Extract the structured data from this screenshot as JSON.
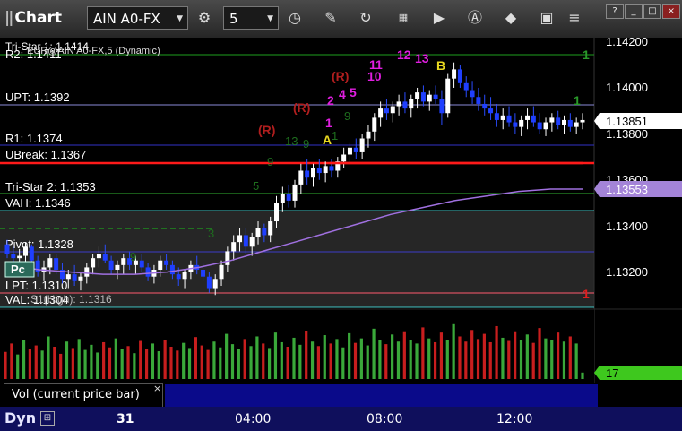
{
  "toolbar": {
    "title": "Chart",
    "symbol": "AIN A0-FX",
    "interval": "5",
    "icons": [
      "gear-icon",
      "clock-icon",
      "pencil-icon",
      "refresh-icon",
      "calculator-icon",
      "play-icon",
      "alert-icon",
      "tag-icon",
      "snapshot-icon",
      "list-icon"
    ],
    "window_buttons": [
      "?",
      "_",
      "□",
      "×"
    ]
  },
  "chart_data": {
    "type": "candlestick",
    "instrument": "AIN A0-FX",
    "interval": "5",
    "price_axis": {
      "range": [
        1.3105,
        1.3426
      ],
      "ticks": [
        "1.14200",
        "1.14000",
        "1.13800",
        "1.13600",
        "1.13400",
        "1.13200"
      ],
      "last_price": "1.13851",
      "ma_price": "1.13553"
    },
    "levels": [
      {
        "label": "R2: 1.1411",
        "value": 1.1411,
        "color": "#1ea01e"
      },
      {
        "label": "UPT: 1.1392",
        "value": 1.1392,
        "color": "#8a8ad8"
      },
      {
        "label": "R1: 1.1374",
        "value": 1.1374,
        "color": "#3232c8"
      },
      {
        "label": "UBreak: 1.1367",
        "value": 1.1367,
        "color": "#ff1a1a"
      },
      {
        "label": "Tri-Star 2: 1.1353",
        "value": 1.1353,
        "color": "#32b432"
      },
      {
        "label": "VAH: 1.1346",
        "value": 1.1346,
        "color": "#46c8c8"
      },
      {
        "label": "Pivot: 1.1328",
        "value": 1.1328,
        "color": "#3c3cc8"
      },
      {
        "label": "LPT: 1.1310",
        "value": 1.131,
        "color": "#ff5a6e"
      },
      {
        "label": "VAL: 1.1304",
        "value": 1.1304,
        "color": "#46c8c8"
      }
    ],
    "overlay_text": [
      "Tri-Star 1: 1.1414",
      "EUR@AIN A0-FX,5 (Dynamic)",
      "S1(High): 1.1316"
    ],
    "annotations": {
      "red": [
        "(R)",
        "(R)",
        "(R)"
      ],
      "magenta": [
        "1",
        "2",
        "4",
        "5",
        "11",
        "10",
        "12",
        "13"
      ],
      "yellow": [
        "A",
        "B"
      ],
      "green": [
        "1",
        "1"
      ],
      "red_count": [
        "1"
      ]
    },
    "ohlc": [
      [
        1.1331,
        1.1333,
        1.1325,
        1.1327
      ],
      [
        1.1327,
        1.133,
        1.1322,
        1.1325
      ],
      [
        1.1325,
        1.1329,
        1.1321,
        1.1326
      ],
      [
        1.1326,
        1.1332,
        1.1323,
        1.133
      ],
      [
        1.133,
        1.1331,
        1.1322,
        1.1324
      ],
      [
        1.1324,
        1.1326,
        1.1317,
        1.1319
      ],
      [
        1.1319,
        1.1324,
        1.1315,
        1.1321
      ],
      [
        1.1321,
        1.1327,
        1.1318,
        1.1325
      ],
      [
        1.1325,
        1.1327,
        1.1318,
        1.132
      ],
      [
        1.132,
        1.1323,
        1.1314,
        1.1316
      ],
      [
        1.1316,
        1.132,
        1.1312,
        1.1318
      ],
      [
        1.1318,
        1.1322,
        1.1313,
        1.1315
      ],
      [
        1.1315,
        1.1319,
        1.1311,
        1.1317
      ],
      [
        1.1317,
        1.1323,
        1.1314,
        1.1321
      ],
      [
        1.1321,
        1.1327,
        1.1318,
        1.1325
      ],
      [
        1.1325,
        1.133,
        1.1321,
        1.1327
      ],
      [
        1.1327,
        1.1331,
        1.1323,
        1.1324
      ],
      [
        1.1324,
        1.1326,
        1.1318,
        1.132
      ],
      [
        1.132,
        1.1324,
        1.1316,
        1.1322
      ],
      [
        1.1322,
        1.1327,
        1.1318,
        1.1325
      ],
      [
        1.1325,
        1.1328,
        1.132,
        1.1322
      ],
      [
        1.1322,
        1.1326,
        1.1318,
        1.1324
      ],
      [
        1.1324,
        1.1327,
        1.1319,
        1.1321
      ],
      [
        1.1321,
        1.1323,
        1.1315,
        1.1317
      ],
      [
        1.1317,
        1.1322,
        1.1314,
        1.132
      ],
      [
        1.132,
        1.1326,
        1.1317,
        1.1324
      ],
      [
        1.1324,
        1.1327,
        1.132,
        1.1322
      ],
      [
        1.1322,
        1.1324,
        1.1316,
        1.1318
      ],
      [
        1.1318,
        1.1321,
        1.1313,
        1.1316
      ],
      [
        1.1316,
        1.132,
        1.1312,
        1.1319
      ],
      [
        1.1319,
        1.1324,
        1.1316,
        1.1322
      ],
      [
        1.1322,
        1.1326,
        1.1318,
        1.132
      ],
      [
        1.132,
        1.1323,
        1.1315,
        1.1317
      ],
      [
        1.1317,
        1.1319,
        1.131,
        1.1312
      ],
      [
        1.1312,
        1.1318,
        1.1309,
        1.1316
      ],
      [
        1.1316,
        1.1324,
        1.1313,
        1.1322
      ],
      [
        1.1322,
        1.133,
        1.1319,
        1.1328
      ],
      [
        1.1328,
        1.1335,
        1.1324,
        1.1332
      ],
      [
        1.1332,
        1.1338,
        1.1328,
        1.1335
      ],
      [
        1.1335,
        1.1338,
        1.1327,
        1.133
      ],
      [
        1.133,
        1.1336,
        1.1326,
        1.1334
      ],
      [
        1.1334,
        1.1341,
        1.1331,
        1.1338
      ],
      [
        1.1338,
        1.134,
        1.1332,
        1.1335
      ],
      [
        1.1335,
        1.1343,
        1.1332,
        1.1341
      ],
      [
        1.1341,
        1.1352,
        1.1338,
        1.1349
      ],
      [
        1.1349,
        1.1356,
        1.1345,
        1.1353
      ],
      [
        1.1353,
        1.1357,
        1.1347,
        1.135
      ],
      [
        1.135,
        1.1359,
        1.1347,
        1.1357
      ],
      [
        1.1357,
        1.1366,
        1.1353,
        1.1363
      ],
      [
        1.1363,
        1.1368,
        1.1357,
        1.136
      ],
      [
        1.136,
        1.1366,
        1.1356,
        1.1364
      ],
      [
        1.1364,
        1.1368,
        1.1359,
        1.1362
      ],
      [
        1.1362,
        1.1367,
        1.1358,
        1.1365
      ],
      [
        1.1365,
        1.1368,
        1.136,
        1.1363
      ],
      [
        1.1363,
        1.1369,
        1.136,
        1.1367
      ],
      [
        1.1367,
        1.1373,
        1.1364,
        1.137
      ],
      [
        1.137,
        1.1375,
        1.1366,
        1.1373
      ],
      [
        1.1373,
        1.1377,
        1.1368,
        1.1371
      ],
      [
        1.1371,
        1.1379,
        1.1368,
        1.1377
      ],
      [
        1.1377,
        1.1383,
        1.1373,
        1.138
      ],
      [
        1.138,
        1.1388,
        1.1376,
        1.1386
      ],
      [
        1.1386,
        1.1393,
        1.1382,
        1.139
      ],
      [
        1.139,
        1.1394,
        1.1385,
        1.1388
      ],
      [
        1.1388,
        1.1393,
        1.1384,
        1.1391
      ],
      [
        1.1391,
        1.1396,
        1.1387,
        1.1393
      ],
      [
        1.1393,
        1.1397,
        1.1388,
        1.139
      ],
      [
        1.139,
        1.1396,
        1.1386,
        1.1394
      ],
      [
        1.1394,
        1.1399,
        1.139,
        1.1397
      ],
      [
        1.1397,
        1.14,
        1.1391,
        1.1393
      ],
      [
        1.1393,
        1.1398,
        1.1389,
        1.1396
      ],
      [
        1.1396,
        1.14,
        1.1392,
        1.1394
      ],
      [
        1.1394,
        1.1398,
        1.1383,
        1.1388
      ],
      [
        1.1388,
        1.1405,
        1.1386,
        1.1403
      ],
      [
        1.1403,
        1.141,
        1.1399,
        1.1407
      ],
      [
        1.1407,
        1.1409,
        1.1399,
        1.1401
      ],
      [
        1.1401,
        1.1404,
        1.1395,
        1.1398
      ],
      [
        1.1398,
        1.1402,
        1.1392,
        1.1395
      ],
      [
        1.1395,
        1.1399,
        1.1389,
        1.1392
      ],
      [
        1.1392,
        1.1396,
        1.1387,
        1.139
      ],
      [
        1.139,
        1.1395,
        1.1385,
        1.1388
      ],
      [
        1.1388,
        1.1392,
        1.1382,
        1.1385
      ],
      [
        1.1385,
        1.139,
        1.1381,
        1.1387
      ],
      [
        1.1387,
        1.1391,
        1.1382,
        1.1384
      ],
      [
        1.1384,
        1.1388,
        1.1379,
        1.1382
      ],
      [
        1.1382,
        1.1387,
        1.1378,
        1.1385
      ],
      [
        1.1385,
        1.139,
        1.1381,
        1.1387
      ],
      [
        1.1387,
        1.1391,
        1.1382,
        1.1384
      ],
      [
        1.1384,
        1.1388,
        1.1379,
        1.1381
      ],
      [
        1.1381,
        1.1386,
        1.1378,
        1.1384
      ],
      [
        1.1384,
        1.1388,
        1.138,
        1.1386
      ],
      [
        1.1386,
        1.1389,
        1.1381,
        1.1383
      ],
      [
        1.1383,
        1.1387,
        1.1379,
        1.1385
      ],
      [
        1.1385,
        1.1388,
        1.138,
        1.1382
      ],
      [
        1.1382,
        1.1386,
        1.1379,
        1.1384
      ],
      [
        1.1384,
        1.1388,
        1.1381,
        1.1385
      ]
    ],
    "ma": [
      1.1322,
      1.132,
      1.1319,
      1.1318,
      1.1318,
      1.1319,
      1.1321,
      1.1324,
      1.1328,
      1.1332,
      1.1336,
      1.134,
      1.1344,
      1.1347,
      1.135,
      1.1352,
      1.1354,
      1.1355,
      1.1355
    ],
    "volume": [
      0.42,
      0.55,
      0.38,
      0.61,
      0.47,
      0.52,
      0.44,
      0.66,
      0.5,
      0.39,
      0.58,
      0.48,
      0.62,
      0.45,
      0.53,
      0.41,
      0.57,
      0.49,
      0.63,
      0.46,
      0.51,
      0.4,
      0.59,
      0.47,
      0.55,
      0.43,
      0.6,
      0.5,
      0.44,
      0.56,
      0.48,
      0.65,
      0.52,
      0.45,
      0.58,
      0.49,
      0.7,
      0.54,
      0.47,
      0.62,
      0.51,
      0.66,
      0.55,
      0.48,
      0.72,
      0.57,
      0.5,
      0.64,
      0.53,
      0.75,
      0.58,
      0.51,
      0.68,
      0.55,
      0.62,
      0.49,
      0.71,
      0.56,
      0.63,
      0.52,
      0.78,
      0.6,
      0.54,
      0.69,
      0.58,
      0.74,
      0.61,
      0.55,
      0.8,
      0.63,
      0.57,
      0.72,
      0.6,
      0.85,
      0.66,
      0.58,
      0.76,
      0.62,
      0.7,
      0.57,
      0.82,
      0.64,
      0.59,
      0.74,
      0.61,
      0.69,
      0.56,
      0.79,
      0.63,
      0.6,
      0.72,
      0.58,
      0.66,
      0.55,
      0.1
    ],
    "volume_value": "17"
  },
  "bottom": {
    "vol_tab": "Vol (current price bar)",
    "close": "×",
    "dyn_label": "Dyn",
    "time_ticks": [
      "31",
      "04:00",
      "08:00",
      "12:00"
    ]
  }
}
